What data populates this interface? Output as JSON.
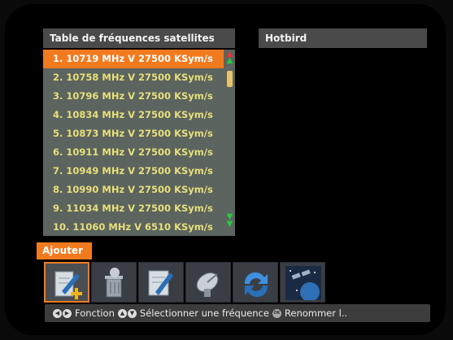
{
  "list_panel": {
    "title": "Table de fréquences satellites"
  },
  "satellite_panel": {
    "name": "Hotbird"
  },
  "frequencies": [
    "1. 10719 MHz V 27500 KSym/s",
    "2. 10758 MHz V 27500 KSym/s",
    "3. 10796 MHz V 27500 KSym/s",
    "4. 10834 MHz V 27500 KSym/s",
    "5. 10873 MHz V 27500 KSym/s",
    "6. 10911 MHz V 27500 KSym/s",
    "7. 10949 MHz V 27500 KSym/s",
    "8. 10990 MHz V 27500 KSym/s",
    "9. 11034 MHz V 27500 KSym/s",
    "10. 11060 MHz V 6510 KSym/s"
  ],
  "selected_index": 0,
  "toolbar": {
    "active_label": "Ajouter",
    "tools": [
      "add-icon",
      "delete-icon",
      "edit-icon",
      "satellite-dish-icon",
      "refresh-icon",
      "satellite-search-icon"
    ]
  },
  "help": {
    "function": "Fonction",
    "select": "Sélectionner une fréquence",
    "rename": "Renommer l.."
  },
  "colors": {
    "highlight": "#f27a1e",
    "row_text": "#e7df79",
    "list_bg": "#5c6460"
  }
}
